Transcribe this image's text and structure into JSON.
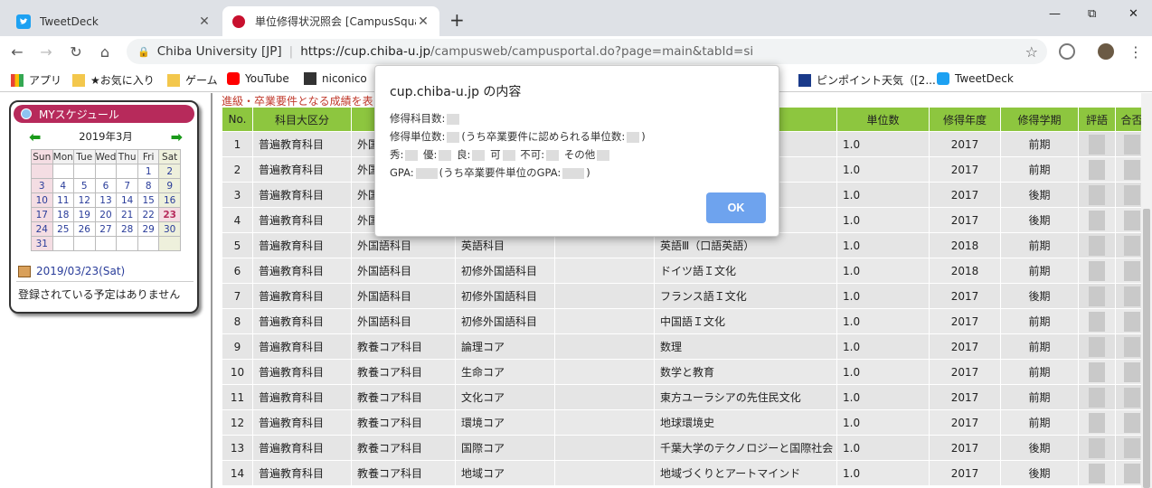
{
  "tabs": [
    {
      "title": "TweetDeck",
      "icon": "twitter-icon"
    },
    {
      "title": "単位修得状況照会 [CampusSquare",
      "icon": "university-icon"
    }
  ],
  "window": {
    "minimize": "—",
    "maximize": "⧉",
    "close": "✕",
    "new_tab": "+"
  },
  "omnibox": {
    "site_label": "Chiba University [JP]",
    "url_host": "https://cup.chiba-u.jp",
    "url_path": "/campusweb/campusportal.do?page=main&tabId=si"
  },
  "bookmarks": [
    {
      "label": "アプリ"
    },
    {
      "label": "★お気に入り"
    },
    {
      "label": "ゲーム"
    },
    {
      "label": "YouTube"
    },
    {
      "label": "niconico"
    },
    {
      "label": "ピンポイント天気（[2..."
    },
    {
      "label": "TweetDeck"
    }
  ],
  "schedule": {
    "title": "MYスケジュール",
    "month": "2019年3月",
    "weekdays": [
      "Sun",
      "Mon",
      "Tue",
      "Wed",
      "Thu",
      "Fri",
      "Sat"
    ],
    "weeks": [
      [
        "",
        "",
        "",
        "",
        "",
        "1",
        "2"
      ],
      [
        "3",
        "4",
        "5",
        "6",
        "7",
        "8",
        "9"
      ],
      [
        "10",
        "11",
        "12",
        "13",
        "14",
        "15",
        "16"
      ],
      [
        "17",
        "18",
        "19",
        "20",
        "21",
        "22",
        "23"
      ],
      [
        "24",
        "25",
        "26",
        "27",
        "28",
        "29",
        "30"
      ],
      [
        "31",
        "",
        "",
        "",
        "",
        "",
        ""
      ]
    ],
    "today": "23",
    "date": "2019/03/23(Sat)",
    "empty_message": "登録されている予定はありません"
  },
  "grid": {
    "title_partial": "進級・卒業要件となる成績を表",
    "headers": [
      "No.",
      "科目大区分",
      "",
      "",
      "",
      "",
      "単位数",
      "修得年度",
      "修得学期",
      "評語",
      "合否"
    ],
    "rows": [
      [
        "1",
        "普遍教育科目",
        "外国",
        "",
        "",
        "",
        "1.0",
        "2017",
        "前期"
      ],
      [
        "2",
        "普遍教育科目",
        "外国",
        "",
        "",
        "",
        "1.0",
        "2017",
        "前期"
      ],
      [
        "3",
        "普遍教育科目",
        "外国",
        "",
        "",
        "",
        "1.0",
        "2017",
        "後期"
      ],
      [
        "4",
        "普遍教育科目",
        "外国",
        "",
        "",
        "",
        "1.0",
        "2017",
        "後期"
      ],
      [
        "5",
        "普遍教育科目",
        "外国語科目",
        "英語科目",
        "",
        "英語Ⅲ（口語英語）",
        "1.0",
        "2018",
        "前期"
      ],
      [
        "6",
        "普遍教育科目",
        "外国語科目",
        "初修外国語科目",
        "",
        "ドイツ語Ｉ文化",
        "1.0",
        "2018",
        "前期"
      ],
      [
        "7",
        "普遍教育科目",
        "外国語科目",
        "初修外国語科目",
        "",
        "フランス語Ｉ文化",
        "1.0",
        "2017",
        "後期"
      ],
      [
        "8",
        "普遍教育科目",
        "外国語科目",
        "初修外国語科目",
        "",
        "中国語Ｉ文化",
        "1.0",
        "2017",
        "前期"
      ],
      [
        "9",
        "普遍教育科目",
        "教養コア科目",
        "論理コア",
        "",
        "数理",
        "1.0",
        "2017",
        "前期"
      ],
      [
        "10",
        "普遍教育科目",
        "教養コア科目",
        "生命コア",
        "",
        "数学と教育",
        "1.0",
        "2017",
        "前期"
      ],
      [
        "11",
        "普遍教育科目",
        "教養コア科目",
        "文化コア",
        "",
        "東方ユーラシアの先住民文化",
        "1.0",
        "2017",
        "前期"
      ],
      [
        "12",
        "普遍教育科目",
        "教養コア科目",
        "環境コア",
        "",
        "地球環境史",
        "1.0",
        "2017",
        "前期"
      ],
      [
        "13",
        "普遍教育科目",
        "教養コア科目",
        "国際コア",
        "",
        "千葉大学のテクノロジーと国際社会",
        "1.0",
        "2017",
        "後期"
      ],
      [
        "14",
        "普遍教育科目",
        "教養コア科目",
        "地域コア",
        "",
        "地域づくりとアートマインド",
        "1.0",
        "2017",
        "後期"
      ]
    ]
  },
  "dialog": {
    "title": "cup.chiba-u.jp の内容",
    "line1_a": "修得科目数:",
    "line2_a": "修得単位数:",
    "line2_b": "(うち卒業要件に認められる単位数:",
    "line2_c": ")",
    "line3_a": "秀:",
    "line3_b": "優:",
    "line3_c": "良:",
    "line3_d": "可",
    "line3_e": "不可:",
    "line3_f": "その他",
    "line4_a": "GPA:",
    "line4_b": "(うち卒業要件単位のGPA:",
    "line4_c": ")",
    "ok_label": "OK"
  },
  "colors": {
    "header_green": "#8dc63f",
    "accent_magenta": "#b72a5b",
    "ok_blue": "#6ea3ee"
  }
}
